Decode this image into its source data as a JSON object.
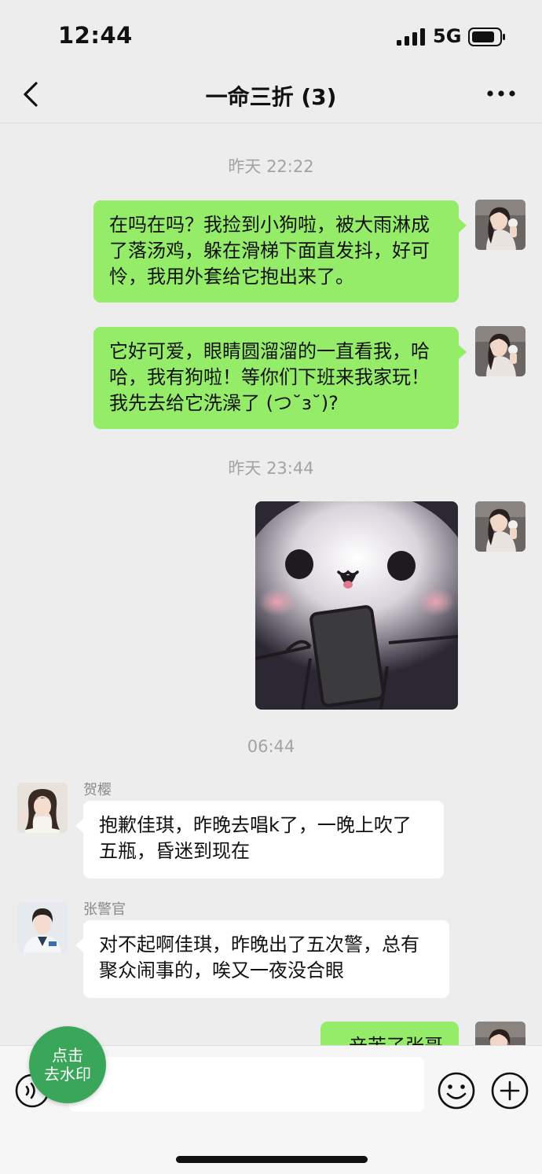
{
  "status_bar": {
    "time": "12:44",
    "network": "5G"
  },
  "nav": {
    "title": "一命三折 (3)"
  },
  "timestamps": [
    "昨天 22:22",
    "昨天 23:44",
    "06:44"
  ],
  "messages": [
    {
      "sender": "me",
      "text": "在吗在吗？我捡到小狗啦，被大雨淋成了落汤鸡，躲在滑梯下面直发抖，好可怜，我用外套给它抱出来了。"
    },
    {
      "sender": "me",
      "text": "它好可爱，眼睛圆溜溜的一直看我，哈哈，我有狗啦！等你们下班来我家玩！我先去给它洗澡了 (つ˘з˘)?"
    },
    {
      "sender": "me",
      "type": "sticker",
      "sticker": "panda-holding-phone"
    },
    {
      "sender_name": "贺樱",
      "text": "抱歉佳琪，昨晚去唱k了，一晚上吹了五瓶，昏迷到现在"
    },
    {
      "sender_name": "张警官",
      "text": "对不起啊佳琪，昨晚出了五次警，总有聚众闹事的，唉又一夜没合眼"
    },
    {
      "sender": "me",
      "text": "辛苦了张哥"
    }
  ],
  "watermark_button": {
    "line1": "点击",
    "line2": "去水印"
  },
  "icons": [
    "back-icon",
    "more-icon",
    "voice-icon",
    "emoji-icon",
    "plus-icon"
  ],
  "colors": {
    "my_bubble": "#95ec69",
    "their_bubble": "#ffffff",
    "background": "#ededed",
    "watermark_button": "#3aa65a"
  }
}
